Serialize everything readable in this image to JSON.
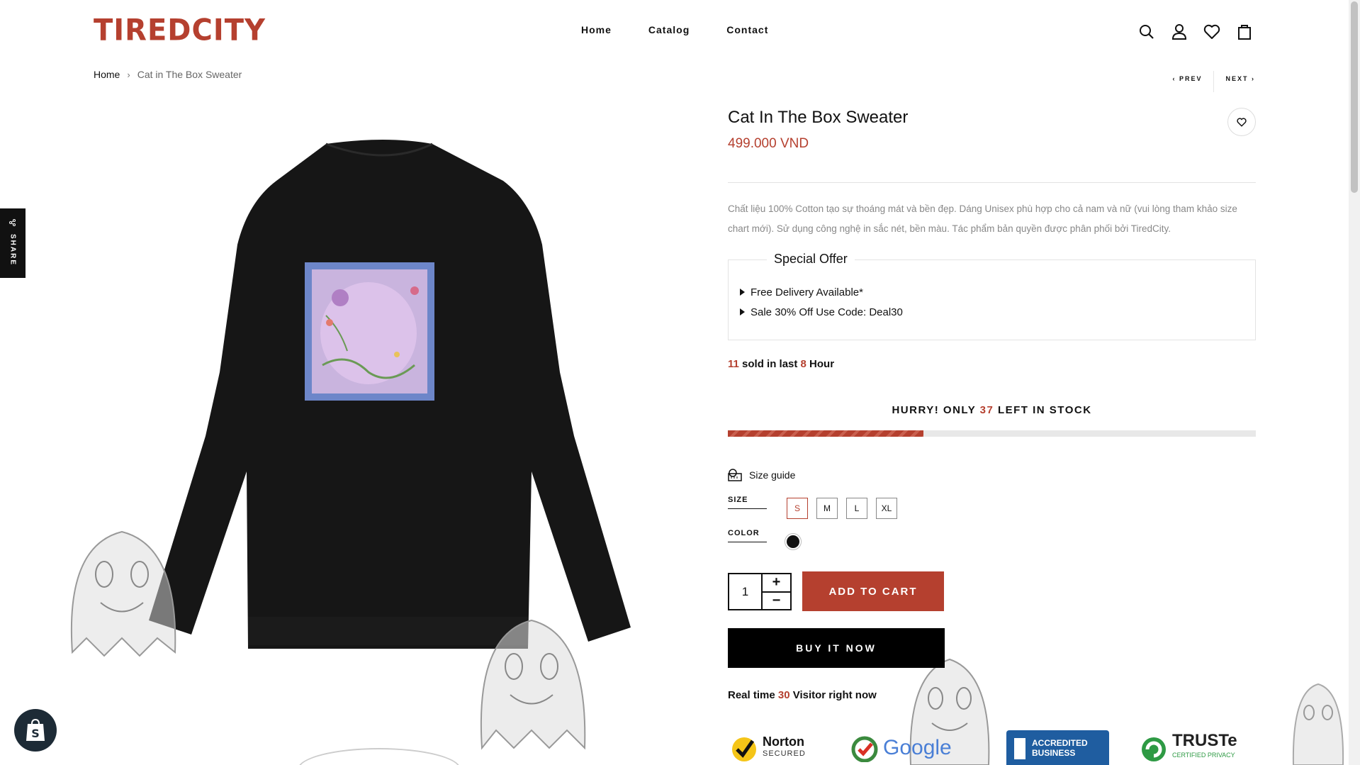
{
  "header": {
    "logo": "TIREDCITY",
    "nav": [
      "Home",
      "Catalog",
      "Contact"
    ],
    "icons": [
      "search-icon",
      "user-icon",
      "heart-icon",
      "cart-icon"
    ]
  },
  "breadcrumb": {
    "home": "Home",
    "separator": "›",
    "current": "Cat in The Box Sweater"
  },
  "pager": {
    "prev": "PREV",
    "next": "NEXT"
  },
  "share": {
    "label": "SHARE"
  },
  "product": {
    "title": "Cat In The Box Sweater",
    "price": "499.000 VND",
    "description": "Chất liệu 100% Cotton tạo sự thoáng mát và bền đẹp. Dáng Unisex phù hợp cho cả nam và nữ (vui lòng tham khảo size chart mới). Sử dụng công nghệ in sắc nét, bền màu. Tác phẩm bản quyền được phân phối bởi TiredCity.",
    "offer_title": "Special Offer",
    "offers": [
      "Free Delivery Available*",
      "Sale 30% Off Use Code: Deal30"
    ],
    "sold": {
      "count": "11",
      "mid": " sold in last ",
      "hours": "8",
      "suffix": " Hour"
    },
    "stock": {
      "prefix": "HURRY! ONLY ",
      "count": "37",
      "suffix": " LEFT IN STOCK",
      "fill_fraction": 0.37
    },
    "size_guide": "Size guide",
    "size_label": "SIZE",
    "sizes": [
      "S",
      "M",
      "L",
      "XL"
    ],
    "selected_size": "S",
    "color_label": "COLOR",
    "color": "#111111",
    "quantity": "1",
    "plus": "+",
    "minus": "−",
    "add_to_cart": "ADD TO CART",
    "buy_now": "BUY IT NOW",
    "visitor": {
      "prefix": "Real time ",
      "count": "30",
      "suffix": " Visitor right now"
    }
  },
  "trust_badges": [
    "Norton",
    "SECURED",
    "Google",
    "ACCREDITED",
    "BUSINESS",
    "TRUSTe",
    "CERTIFIED PRIVACY"
  ],
  "colors": {
    "accent": "#b5402f",
    "dark": "#111111"
  }
}
